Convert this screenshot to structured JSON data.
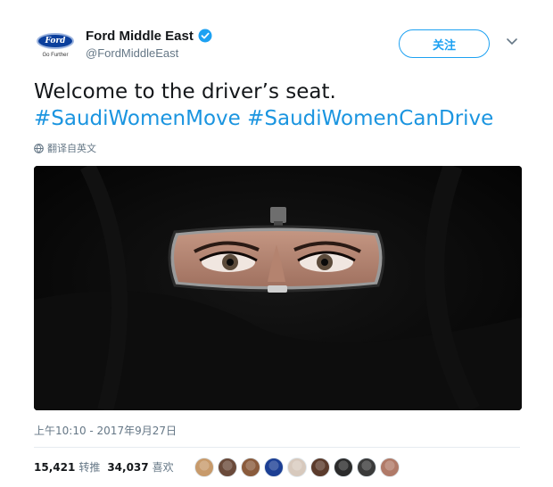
{
  "account": {
    "display_name": "Ford Middle East",
    "handle": "@FordMiddleEast",
    "logo_text": "Ford",
    "logo_tagline": "Go Further",
    "verified": true
  },
  "follow_button_label": "关注",
  "tweet": {
    "text": "Welcome to the driver’s seat.",
    "hashtag_1": "#SaudiWomenMove",
    "hashtag_2": "#SaudiWomenCanDrive",
    "translate_label": "翻译自英文",
    "timestamp": "上午10:10 - 2017年9月27日"
  },
  "stats": {
    "retweets_count": "15,421",
    "retweets_label": "转推",
    "likes_count": "34,037",
    "likes_label": "喜欢"
  },
  "likers": [
    {
      "icon": "user-avatar-1",
      "color": "#c79a6b"
    },
    {
      "icon": "user-avatar-2",
      "color": "#6a4a3a"
    },
    {
      "icon": "user-avatar-3",
      "color": "#8a5b3c"
    },
    {
      "icon": "ford-logo-avatar",
      "color": "#1c3f94"
    },
    {
      "icon": "user-avatar-5",
      "color": "#d7c9bd"
    },
    {
      "icon": "user-avatar-6",
      "color": "#5b3b2c"
    },
    {
      "icon": "user-avatar-7",
      "color": "#2b2b2b"
    },
    {
      "icon": "user-avatar-8",
      "color": "#3a3a3a"
    },
    {
      "icon": "user-avatar-9",
      "color": "#b07a68"
    }
  ],
  "colors": {
    "link_blue": "#1b95e0",
    "follow_blue": "#1da1f2",
    "ford_blue": "#0b3f9c",
    "muted_gray": "#657786"
  }
}
